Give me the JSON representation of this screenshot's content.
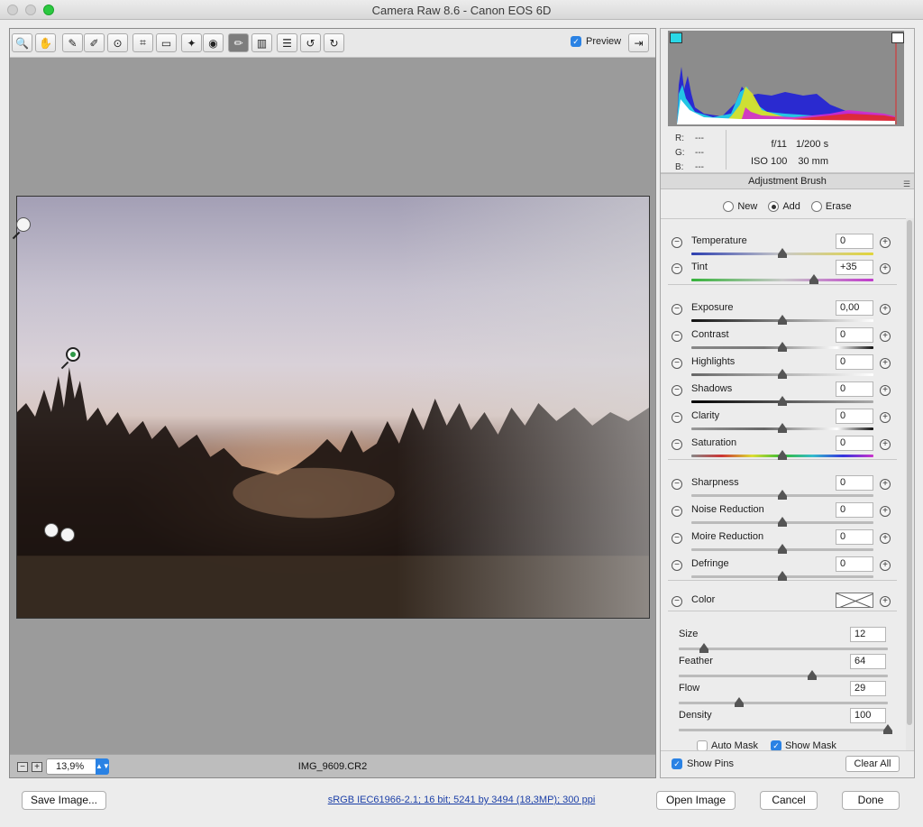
{
  "window": {
    "title": "Camera Raw 8.6  -  Canon EOS 6D"
  },
  "toolbar": {
    "tools": [
      {
        "name": "zoom-tool",
        "icon": "magnifier-icon",
        "glyph": "🔍"
      },
      {
        "name": "hand-tool",
        "icon": "hand-icon",
        "glyph": "✋"
      },
      {
        "name": "white-balance-tool",
        "icon": "eyedropper-icon",
        "glyph": "✎"
      },
      {
        "name": "color-sampler-tool",
        "icon": "color-sampler-icon",
        "glyph": "✐"
      },
      {
        "name": "targeted-adjustment-tool",
        "icon": "target-icon",
        "glyph": "⊙"
      },
      {
        "name": "crop-tool",
        "icon": "crop-icon",
        "glyph": "⌗"
      },
      {
        "name": "straighten-tool",
        "icon": "level-icon",
        "glyph": "▭"
      },
      {
        "name": "spot-removal-tool",
        "icon": "healing-brush-icon",
        "glyph": "✦"
      },
      {
        "name": "red-eye-tool",
        "icon": "eye-icon",
        "glyph": "◉"
      },
      {
        "name": "adjustment-brush-tool",
        "icon": "brush-icon",
        "glyph": "✏"
      },
      {
        "name": "graduated-filter-tool",
        "icon": "gradient-icon",
        "glyph": "▥"
      },
      {
        "name": "preferences-button",
        "icon": "list-icon",
        "glyph": "☰"
      },
      {
        "name": "rotate-ccw-button",
        "icon": "rotate-left-icon",
        "glyph": "↺"
      },
      {
        "name": "rotate-cw-button",
        "icon": "rotate-right-icon",
        "glyph": "↻"
      }
    ],
    "preview_label": "Preview",
    "preview_checked": true
  },
  "status": {
    "zoom": "13,9%",
    "filename": "IMG_9609.CR2"
  },
  "exif": {
    "r_label": "R:",
    "g_label": "G:",
    "b_label": "B:",
    "r": "---",
    "g": "---",
    "b": "---",
    "aperture": "f/11",
    "shutter": "1/200 s",
    "iso": "ISO 100",
    "focal": "30 mm"
  },
  "panel": {
    "title": "Adjustment Brush",
    "modes": [
      {
        "label": "New",
        "on": false
      },
      {
        "label": "Add",
        "on": true
      },
      {
        "label": "Erase",
        "on": false
      }
    ]
  },
  "sliders": [
    {
      "label": "Temperature",
      "value": "0",
      "pos": 0.5,
      "track": "linear-gradient(90deg,#2d3fb0,#c9c9c9,#e1d43a)"
    },
    {
      "label": "Tint",
      "value": "+35",
      "pos": 0.675,
      "track": "linear-gradient(90deg,#35b23a,#c9c9c9,#c03acb)"
    },
    {
      "label": "Exposure",
      "value": "0,00",
      "pos": 0.5,
      "track": "linear-gradient(90deg,#111,#fff)"
    },
    {
      "label": "Contrast",
      "value": "0",
      "pos": 0.5,
      "track": "linear-gradient(90deg,#888,#777 40%,#fff 80%,#111)"
    },
    {
      "label": "Highlights",
      "value": "0",
      "pos": 0.5,
      "track": "linear-gradient(90deg,#666,#fff)"
    },
    {
      "label": "Shadows",
      "value": "0",
      "pos": 0.5,
      "track": "linear-gradient(90deg,#000,#aaa)"
    },
    {
      "label": "Clarity",
      "value": "0",
      "pos": 0.5,
      "track": "linear-gradient(90deg,#999,#666 40%,#fff 80%,#111)"
    },
    {
      "label": "Saturation",
      "value": "0",
      "pos": 0.5,
      "track": "linear-gradient(90deg,#888,#c33,#dd3,#3b3,#3bc,#33d,#c3c)"
    },
    {
      "label": "Sharpness",
      "value": "0",
      "pos": 0.5,
      "track": "linear-gradient(90deg,#bbb,#bbb)"
    },
    {
      "label": "Noise Reduction",
      "value": "0",
      "pos": 0.5,
      "track": "linear-gradient(90deg,#bbb,#bbb)"
    },
    {
      "label": "Moire Reduction",
      "value": "0",
      "pos": 0.5,
      "track": "linear-gradient(90deg,#bbb,#bbb)"
    },
    {
      "label": "Defringe",
      "value": "0",
      "pos": 0.5,
      "track": "linear-gradient(90deg,#bbb,#bbb)"
    }
  ],
  "color": {
    "label": "Color"
  },
  "brush": [
    {
      "label": "Size",
      "value": "12",
      "pos": 0.12
    },
    {
      "label": "Feather",
      "value": "64",
      "pos": 0.64
    },
    {
      "label": "Flow",
      "value": "29",
      "pos": 0.29
    },
    {
      "label": "Density",
      "value": "100",
      "pos": 1.0
    }
  ],
  "mask": {
    "auto_mask": "Auto Mask",
    "show_mask": "Show Mask"
  },
  "pins": {
    "label": "Show Pins",
    "checked": true,
    "clear_all": "Clear All"
  },
  "footer": {
    "save": "Save Image...",
    "workflow": "sRGB IEC61966-2.1; 16 bit; 5241 by 3494 (18,3MP); 300 ppi",
    "open": "Open Image",
    "cancel": "Cancel",
    "done": "Done"
  },
  "colors": {
    "accent": "#2a82e4",
    "panel": "#ececec",
    "canvas": "#9b9b9b"
  }
}
